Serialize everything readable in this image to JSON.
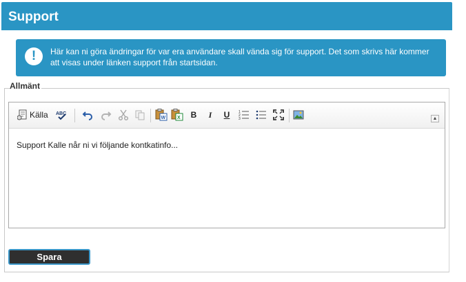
{
  "page": {
    "title": "Support"
  },
  "info": {
    "icon": "!",
    "text": "Här kan ni göra ändringar för var era användare skall vända sig för support. Det som skrivs här kommer att visas under länken support från startsidan."
  },
  "section": {
    "legend": "Allmänt"
  },
  "editor": {
    "toolbar": {
      "source_label": "Källa",
      "bold": "B",
      "italic": "I",
      "underline": "U"
    },
    "content": "Support Kalle når ni vi följande kontkatinfo..."
  },
  "actions": {
    "save_label": "Spara"
  },
  "colors": {
    "accent": "#2a95c4",
    "button": "#2f2f2f"
  }
}
